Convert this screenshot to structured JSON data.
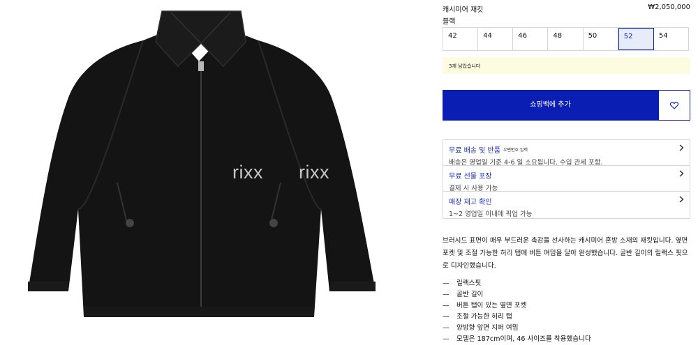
{
  "product": {
    "name": "캐시미어 재킷",
    "price": "₩2,050,000",
    "color": "블랙",
    "watermark": "rixx"
  },
  "sizes": {
    "options": [
      "42",
      "44",
      "46",
      "48",
      "50",
      "52",
      "54"
    ],
    "selected": "52"
  },
  "stock_notice": "3개 남았습니다",
  "actions": {
    "add_to_bag": "쇼핑백에 추가",
    "wishlist_icon": "heart-icon"
  },
  "accordions": [
    {
      "title": "무료 배송 및 반품",
      "sub": "우편번호 입력",
      "desc": "배송은 영업일 기준 4-6 일 소요됩니다. 수입 관세 포함."
    },
    {
      "title": "무료 선물 포장",
      "sub": "",
      "desc": "결제 시 사용 가능"
    },
    {
      "title": "매장 재고 확인",
      "sub": "",
      "desc": "1~2 영업일 이내에 픽업 가능"
    }
  ],
  "description": "브러시드 표면이 매우 부드러운 촉감을 선사하는 캐시미어 혼방 소재의 재킷입니다. 옆면 포켓 및 조절 가능한 허리 탭에 버튼 여밈을 달아 완성했습니다. 골반 길이의 릴랙스 핏으로 디자인했습니다.",
  "features": [
    "릴랙스핏",
    "골반 길이",
    "버튼 탭이 있는 옆면 포켓",
    "조절 가능한 허리 탭",
    "양방향 앞면 지퍼 여밈",
    "모델은 187cm이며, 46 사이즈를 착용했습니다"
  ],
  "colors": {
    "accent": "#0a1eb4",
    "selected_bg": "#e6ecf9",
    "notice_bg": "#fdfbe0",
    "jacket": "#141414"
  }
}
